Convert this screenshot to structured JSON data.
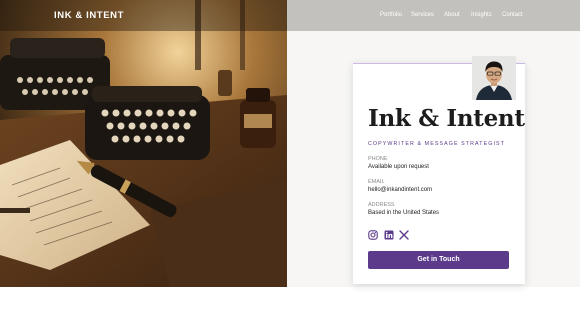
{
  "nav": {
    "brand": "INK & INTENT",
    "links": [
      "Portfolio",
      "Services",
      "About",
      "Insights",
      "Contact"
    ]
  },
  "hero": {
    "image_desc": "typewriter-and-fountain-pen-desk-photo"
  },
  "card": {
    "title": "Ink & Intent",
    "subtitle": "COPYWRITER & MESSAGE STRATEGIST",
    "phone_label": "PHONE",
    "phone_value": "Available upon request",
    "email_label": "EMAIL",
    "email_value": "hello@inkandintent.com",
    "address_label": "ADDRESS",
    "address_value": "Based in the United States",
    "social_icons": [
      "instagram-icon",
      "linkedin-icon",
      "x-icon"
    ],
    "cta_label": "Get in Touch"
  },
  "colors": {
    "accent": "#5b3b8a",
    "nav_right_bg": "#c2c1bd",
    "page_bg": "#f7f6f4"
  }
}
